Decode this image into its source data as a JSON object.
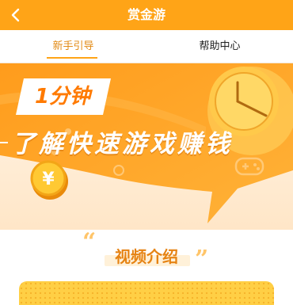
{
  "header": {
    "title": "赏金游",
    "back_icon": "chevron-left-icon"
  },
  "tabs": [
    {
      "label": "新手引导",
      "active": true
    },
    {
      "label": "帮助中心",
      "active": false
    }
  ],
  "banner": {
    "headline_line1": "1分钟",
    "headline_line2": "了解快速游戏赚钱",
    "coin_symbol": "¥",
    "icons": [
      "clock-icon",
      "coin-icon",
      "gamepad-icon"
    ]
  },
  "section": {
    "open_quote": "“",
    "close_quote": "”",
    "title": "视频介绍"
  },
  "colors": {
    "accent": "#ffa417",
    "tab_active": "#e28a14",
    "banner_orange": "#ff9a12",
    "banner_light": "#ffe9cf"
  }
}
